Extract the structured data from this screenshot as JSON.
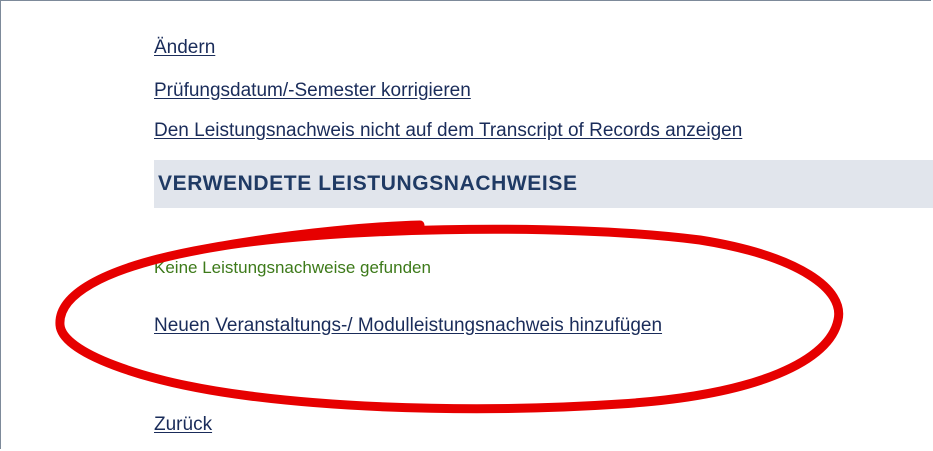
{
  "links": {
    "change": "Ändern",
    "correct_date": "Prüfungsdatum/-Semester korrigieren",
    "hide_transcript": "Den Leistungsnachweis nicht auf dem Transcript of Records anzeigen"
  },
  "section": {
    "title": "VERWENDETE LEISTUNGSNACHWEISE",
    "empty_message": "Keine Leistungsnachweise gefunden",
    "add_link": "Neuen Veranstaltungs-/ Modulleistungsnachweis hinzufügen"
  },
  "footer": {
    "back_link": "Zurück"
  },
  "colors": {
    "link": "#1a2c5a",
    "header_bg": "#e1e5ec",
    "header_text": "#1f3a64",
    "empty_message": "#3d7a1a",
    "annotation": "#e60000"
  }
}
